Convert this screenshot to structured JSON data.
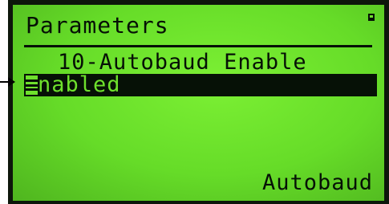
{
  "screen": {
    "title": "Parameters",
    "parameter_name": "10-Autobaud Enable",
    "selected_value": "nabled",
    "footer_label": "Autobaud"
  },
  "colors": {
    "lcd_background": "#6ee02c",
    "lcd_text": "#061106",
    "bezel": "#0d160b"
  },
  "icons": {
    "status_indicator": "square-indicator-icon",
    "callout_pointer": "arrow-right-icon"
  }
}
